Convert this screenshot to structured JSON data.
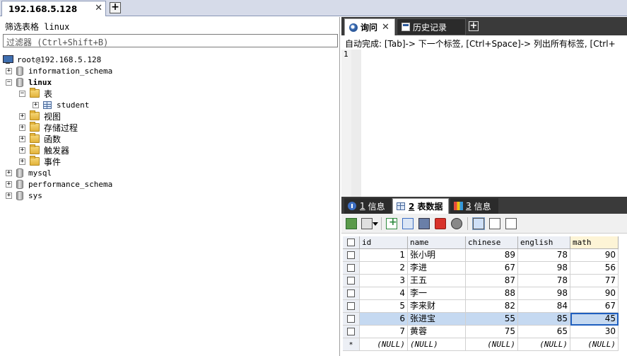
{
  "connection_tab": {
    "label": "192.168.5.128",
    "close": "✕",
    "add": "+"
  },
  "left": {
    "filter_label": "筛选表格 linux",
    "filter_placeholder": "过滤器 (Ctrl+Shift+B)",
    "tree": {
      "root": "root@192.168.5.128",
      "databases": [
        "information_schema",
        "linux",
        "mysql",
        "performance_schema",
        "sys"
      ],
      "linux_children": {
        "tables_folder": "表",
        "table": "student",
        "views": "视图",
        "procedures": "存储过程",
        "functions": "函数",
        "triggers": "触发器",
        "events": "事件"
      },
      "expand_plus": "+",
      "expand_minus": "−"
    }
  },
  "query_tabs": {
    "query": "询问",
    "history": "历史记录",
    "close": "✕",
    "add": "+"
  },
  "editor": {
    "autocomplete_hint": "自动完成: [Tab]-> 下一个标签, [Ctrl+Space]-> 列出所有标签, [Ctrl+",
    "line_number": "1"
  },
  "result_tabs": {
    "t1_num": "1",
    "t1_label": "信息",
    "t2_num": "2",
    "t2_label": "表数据",
    "t3_num": "3",
    "t3_label": "信息"
  },
  "grid": {
    "columns": [
      "id",
      "name",
      "chinese",
      "english",
      "math"
    ],
    "rows": [
      [
        "1",
        "张小明",
        "89",
        "78",
        "90"
      ],
      [
        "2",
        "李进",
        "67",
        "98",
        "56"
      ],
      [
        "3",
        "王五",
        "87",
        "78",
        "77"
      ],
      [
        "4",
        "李一",
        "88",
        "98",
        "90"
      ],
      [
        "5",
        "李来财",
        "82",
        "84",
        "67"
      ],
      [
        "6",
        "张进宝",
        "55",
        "85",
        "45"
      ],
      [
        "7",
        "黄蓉",
        "75",
        "65",
        "30"
      ]
    ],
    "null_row": [
      "(NULL)",
      "(NULL)",
      "(NULL)",
      "(NULL)",
      "(NULL)"
    ],
    "new_row_marker": "*",
    "selected_row_index": 5
  },
  "colors": {
    "tab_bar_dark": "#3a3a3a",
    "selection": "#c5d9f1",
    "header_bg": "#eceff5"
  }
}
